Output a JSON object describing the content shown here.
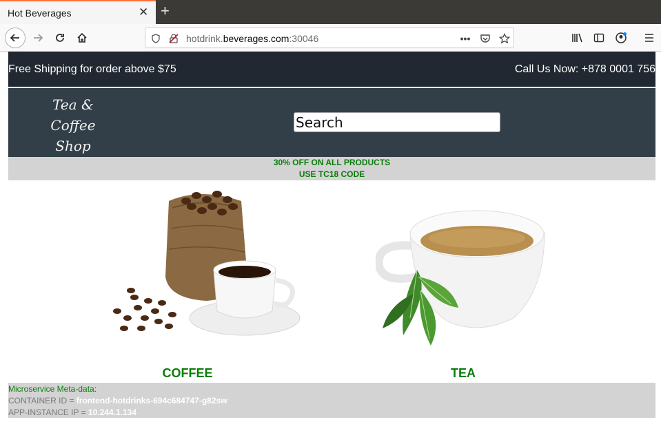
{
  "browser": {
    "tab_title": "Hot Beverages",
    "url_domain_prefix": "hotdrink.",
    "url_domain": "beverages.com",
    "url_port": ":30046"
  },
  "topbar": {
    "shipping": "Free Shipping for order above $75",
    "call": "Call Us Now: +878 0001 756"
  },
  "header": {
    "logo_line1": "Tea & Coffee",
    "logo_line2": "Shop",
    "search_value": "Search"
  },
  "promo": {
    "line1": "30% OFF ON ALL PRODUCTS",
    "line2": "USE TC18 CODE"
  },
  "products": [
    {
      "label": "COFFEE",
      "icon": "coffee-image"
    },
    {
      "label": "TEA",
      "icon": "tea-image"
    }
  ],
  "meta": {
    "title": "Microservice Meta-data:",
    "container_label": "CONTAINER ID = ",
    "container_id": "frontend-hotdrinks-694c684747-g82sw",
    "ip_label": "APP-INSTANCE IP = ",
    "ip": "10.244.1.134"
  },
  "colors": {
    "topbar_bg": "#222831",
    "header_bg": "#323f48",
    "accent_green": "#0a7d0a",
    "panel_grey": "#d3d3d3"
  }
}
